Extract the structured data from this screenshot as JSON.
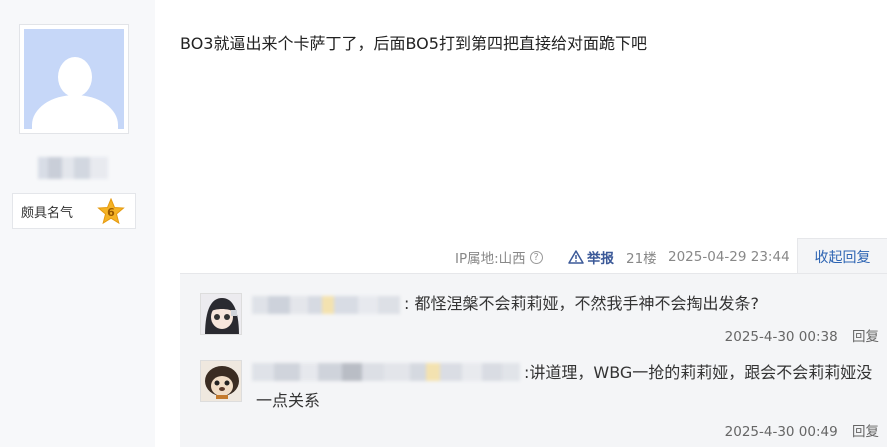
{
  "post": {
    "author": {
      "level_title": "颇具名气",
      "level": "6"
    },
    "content": "BO3就逼出来个卡萨丁了，后面BO5打到第四把直接给对面跪下吧",
    "tail": {
      "ip_location": "IP属地:山西",
      "report_label": "举报",
      "floor": "21楼",
      "time": "2025-04-29 23:44",
      "collapse_label": "收起回复"
    }
  },
  "sub_replies": [
    {
      "text": ": 都怪涅槃不会莉莉娅，不然我手神不会掏出发条?",
      "time": "2025-4-30 00:38",
      "reply_label": "回复"
    },
    {
      "text": ":讲道理，WBG一抢的莉莉娅，跟会不会莉莉娅没一点关系",
      "time": "2025-4-30 00:49",
      "reply_label": "回复"
    }
  ],
  "colors": {
    "link": "#2d64b3",
    "report": "#3b5998",
    "avatar_bg": "#c6d7f8",
    "level_star": "#f5b325"
  },
  "icons": {
    "help": "question-circle-icon",
    "report": "warning-triangle-icon",
    "level": "star-badge-icon"
  }
}
